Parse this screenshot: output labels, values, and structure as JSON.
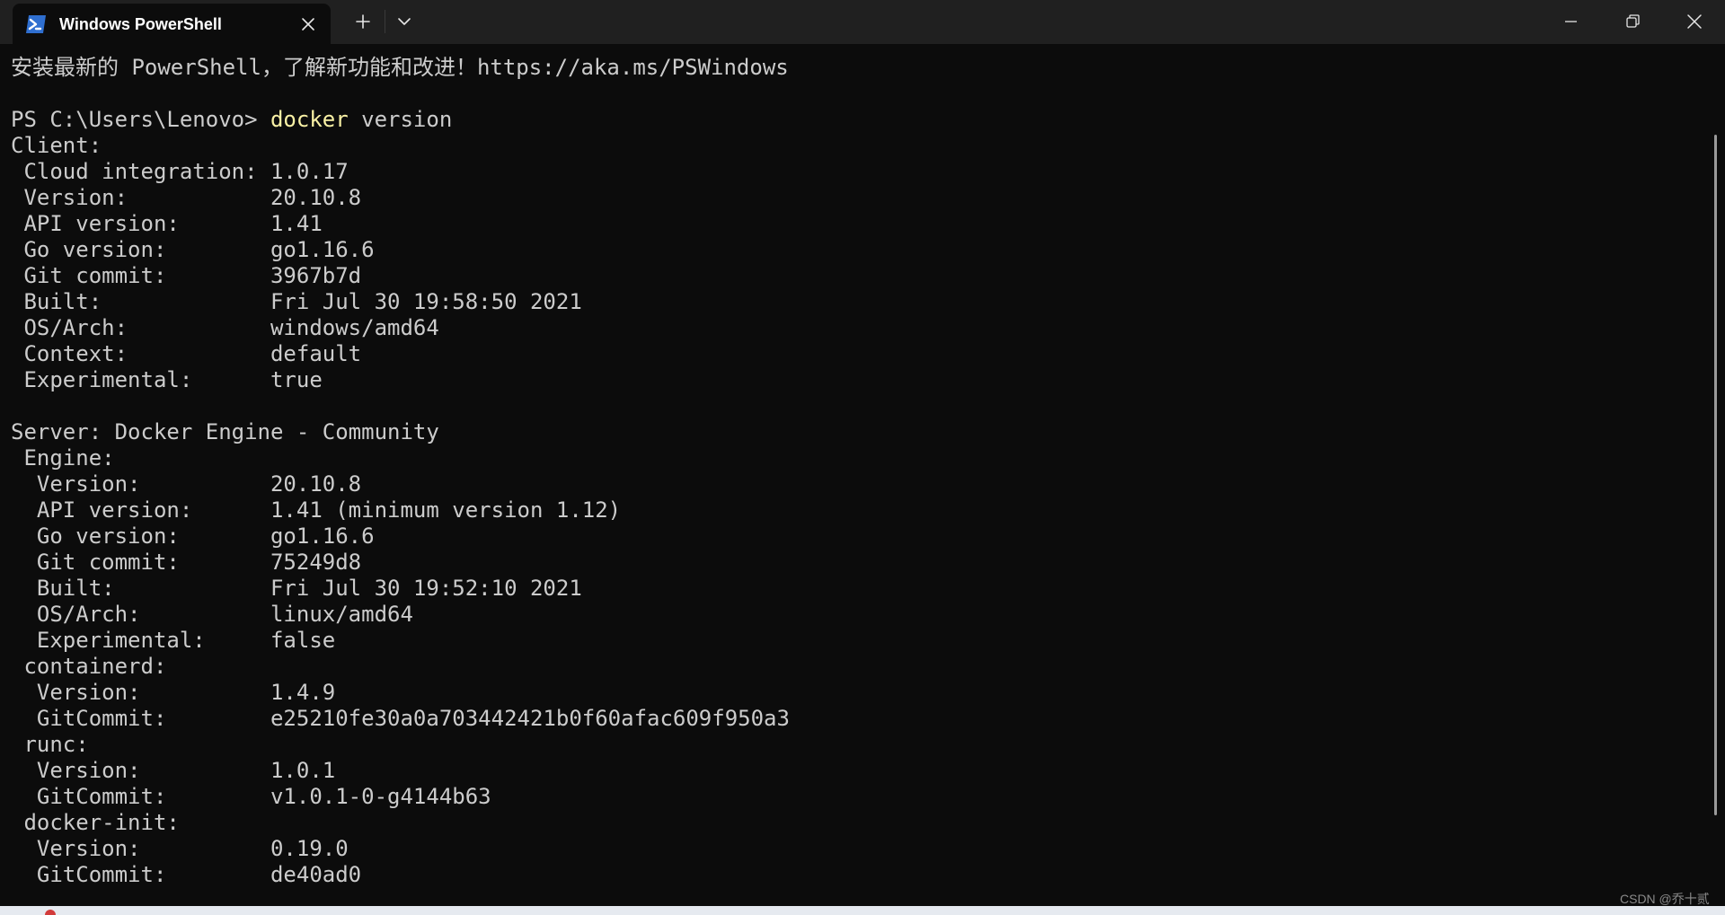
{
  "window": {
    "tab_title": "Windows PowerShell",
    "tab_icon": "powershell-icon",
    "buttons": {
      "new_tab": "plus-icon",
      "dropdown": "chevron-down-icon",
      "minimize": "minimize-icon",
      "restore": "restore-icon",
      "close": "close-icon"
    }
  },
  "colors": {
    "background": "#0c0c0c",
    "titlebar": "#202020",
    "text": "#cccccc",
    "command": "#f9f1a5"
  },
  "terminal": {
    "banner": "安装最新的 PowerShell，了解新功能和改进！https://aka.ms/PSWindows",
    "prompt": "PS C:\\Users\\Lenovo> ",
    "command": "docker",
    "command_args": " version",
    "output": [
      "Client:",
      " Cloud integration: 1.0.17",
      " Version:           20.10.8",
      " API version:       1.41",
      " Go version:        go1.16.6",
      " Git commit:        3967b7d",
      " Built:             Fri Jul 30 19:58:50 2021",
      " OS/Arch:           windows/amd64",
      " Context:           default",
      " Experimental:      true",
      "",
      "Server: Docker Engine - Community",
      " Engine:",
      "  Version:          20.10.8",
      "  API version:      1.41 (minimum version 1.12)",
      "  Go version:       go1.16.6",
      "  Git commit:       75249d8",
      "  Built:            Fri Jul 30 19:52:10 2021",
      "  OS/Arch:          linux/amd64",
      "  Experimental:     false",
      " containerd:",
      "  Version:          1.4.9",
      "  GitCommit:        e25210fe30a0a703442421b0f60afac609f950a3",
      " runc:",
      "  Version:          1.0.1",
      "  GitCommit:        v1.0.1-0-g4144b63",
      " docker-init:",
      "  Version:          0.19.0",
      "  GitCommit:        de40ad0"
    ]
  },
  "watermark": "CSDN @乔十贰"
}
